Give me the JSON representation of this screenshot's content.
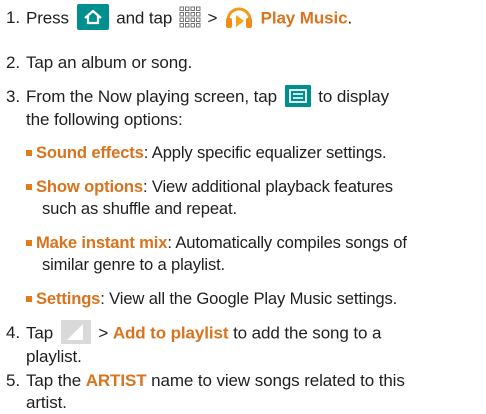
{
  "steps": [
    {
      "num": "1.",
      "text_a": "Press",
      "text_b": "and tap",
      "gt": ">",
      "app_name": "Play Music",
      "end": "."
    },
    {
      "num": "2.",
      "text": "Tap an album or song."
    },
    {
      "num": "3.",
      "line1_a": "From the Now playing screen, tap",
      "line1_b": "to display",
      "line2": "the following options:"
    },
    {
      "num": "4.",
      "text_a": "Tap",
      "gt": ">",
      "action": "Add to playlist",
      "text_b": "to add the song to a",
      "line2": "playlist."
    },
    {
      "num": "5.",
      "text_a": "Tap the",
      "keyword": "ARTIST",
      "text_b": "name to view songs related to this",
      "line2": "artist."
    }
  ],
  "options": [
    {
      "term": "Sound effects",
      "desc": ": Apply specific equalizer settings."
    },
    {
      "term": "Show options",
      "desc": ": View additional playback features",
      "desc2": "such as shuffle and repeat."
    },
    {
      "term": "Make instant mix",
      "desc": ": Automatically compiles songs of",
      "desc2": "similar genre to a playlist."
    },
    {
      "term": "Settings",
      "desc": ": View all the Google Play Music settings."
    }
  ],
  "icons": {
    "home": "home-icon",
    "apps": "apps-grid-icon",
    "play_music": "play-music-icon",
    "menu": "menu-icon",
    "overflow": "overflow-corner-icon"
  },
  "colors": {
    "accent": "#d9731d",
    "bullet": "#e07b1f",
    "icon_teal": "#008f8f",
    "text": "#1f1f1f"
  }
}
